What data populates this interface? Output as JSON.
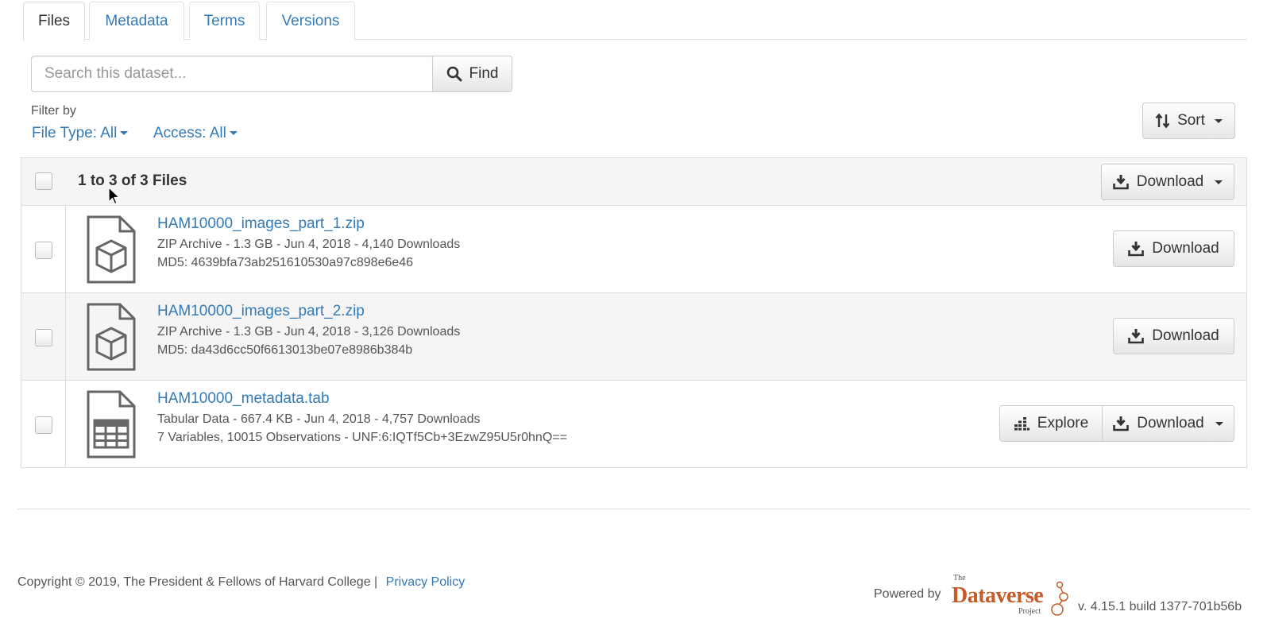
{
  "tabs": [
    {
      "label": "Files",
      "active": true
    },
    {
      "label": "Metadata",
      "active": false
    },
    {
      "label": "Terms",
      "active": false
    },
    {
      "label": "Versions",
      "active": false
    }
  ],
  "search": {
    "placeholder": "Search this dataset...",
    "value": "",
    "find_label": "Find"
  },
  "filters": {
    "label": "Filter by",
    "file_type": "File Type: All",
    "access": "Access: All"
  },
  "sort_label": "Sort",
  "table": {
    "count_label": "1 to 3 of 3 Files",
    "download_all_label": "Download",
    "files": [
      {
        "name": "HAM10000_images_part_1.zip",
        "details": "ZIP Archive - 1.3 GB - Jun 4, 2018 - 4,140 Downloads",
        "hash": "MD5: 4639bfa73ab251610530a97c898e6e46",
        "icon": "zip-archive-icon",
        "download_label": "Download"
      },
      {
        "name": "HAM10000_images_part_2.zip",
        "details": "ZIP Archive - 1.3 GB - Jun 4, 2018 - 3,126 Downloads",
        "hash": "MD5: da43d6cc50f6613013be07e8986b384b",
        "icon": "zip-archive-icon",
        "download_label": "Download"
      },
      {
        "name": "HAM10000_metadata.tab",
        "details": "Tabular Data - 667.4 KB - Jun 4, 2018 - 4,757 Downloads",
        "hash": "7 Variables, 10015 Observations - UNF:6:IQTf5Cb+3EzwZ95U5r0hnQ==",
        "icon": "tabular-data-icon",
        "explore_label": "Explore",
        "download_label": "Download"
      }
    ]
  },
  "footer": {
    "copyright": "Copyright © 2019, The President & Fellows of Harvard College |",
    "privacy": "Privacy Policy",
    "powered_by": "Powered by",
    "version": "v. 4.15.1 build 1377-701b56b"
  },
  "logo": {
    "the": "The",
    "name": "Dataverse",
    "project": "Project"
  },
  "colors": {
    "link": "#337ab7",
    "logo": "#c55b28"
  }
}
